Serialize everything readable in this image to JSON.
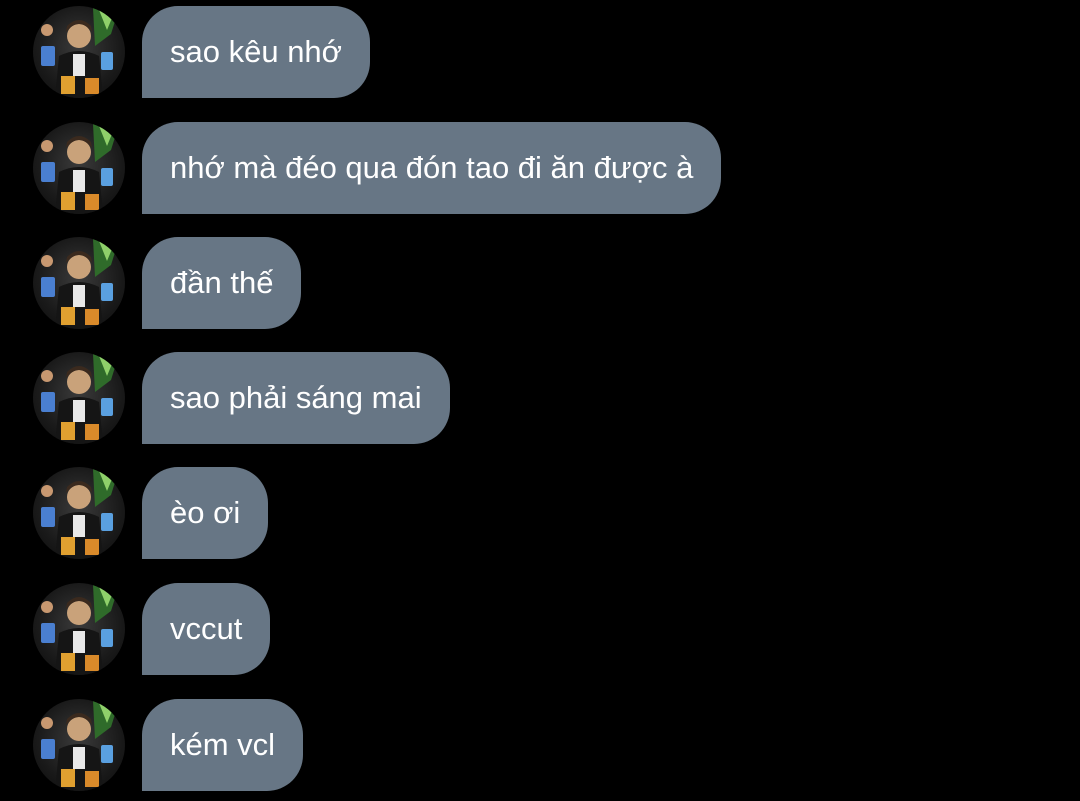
{
  "colors": {
    "background": "#000000",
    "bubble": "#677685",
    "text": "#ffffff"
  },
  "messages": [
    {
      "text": "sao kêu nhớ",
      "avatar_icon": "user-photo-avatar"
    },
    {
      "text": "nhớ mà đéo qua đón tao đi ăn được à",
      "avatar_icon": "user-photo-avatar"
    },
    {
      "text": "đần thế",
      "avatar_icon": "user-photo-avatar"
    },
    {
      "text": "sao phải sáng mai",
      "avatar_icon": "user-photo-avatar"
    },
    {
      "text": "èo ơi",
      "avatar_icon": "user-photo-avatar"
    },
    {
      "text": "vccut",
      "avatar_icon": "user-photo-avatar"
    },
    {
      "text": "kém vcl",
      "avatar_icon": "user-photo-avatar"
    }
  ]
}
